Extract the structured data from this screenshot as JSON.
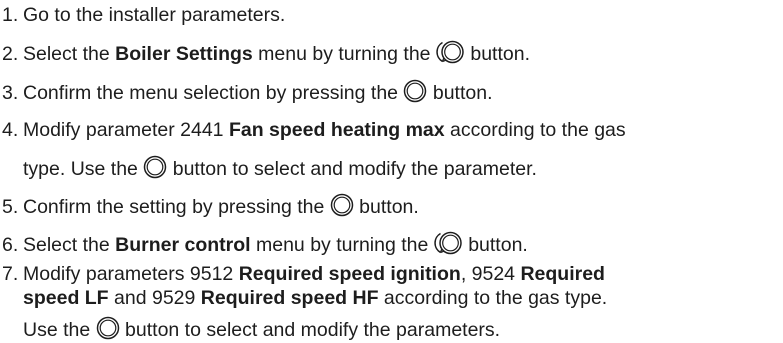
{
  "steps": [
    {
      "num": "1.",
      "text": "Go to the installer parameters."
    },
    {
      "num": "2.",
      "t1": "Select the ",
      "b1": "Boiler Settings",
      "t2": " menu by turning the ",
      "t3": " button."
    },
    {
      "num": "3.",
      "t1": "Confirm the menu selection by pressing the ",
      "t2": " button."
    },
    {
      "num": "4.",
      "t1": "Modify parameter 2441 ",
      "b1": "Fan speed heating max",
      "t2": " according to the gas",
      "l2a": "type. Use the ",
      "l2b": " button to select and modify the parameter."
    },
    {
      "num": "5.",
      "t1": "Confirm the setting by pressing the ",
      "t2": " button."
    },
    {
      "num": "6.",
      "t1": "Select the ",
      "b1": "Burner control",
      "t2": " menu by turning the ",
      "t3": " button."
    },
    {
      "num": "7.",
      "t1": "Modify parameters 9512 ",
      "b1": "Required speed ignition",
      "t2": ", 9524 ",
      "b2": "Required",
      "l2b1": "speed LF",
      "l2t1": " and 9529 ",
      "l2b2": "Required speed HF",
      "l2t2": " according to the gas type.",
      "l3a": "Use the ",
      "l3b": " button to select and modify the parameters."
    }
  ],
  "icons": {
    "press": "round-button-icon",
    "turn": "rotary-knob-turn-icon"
  }
}
